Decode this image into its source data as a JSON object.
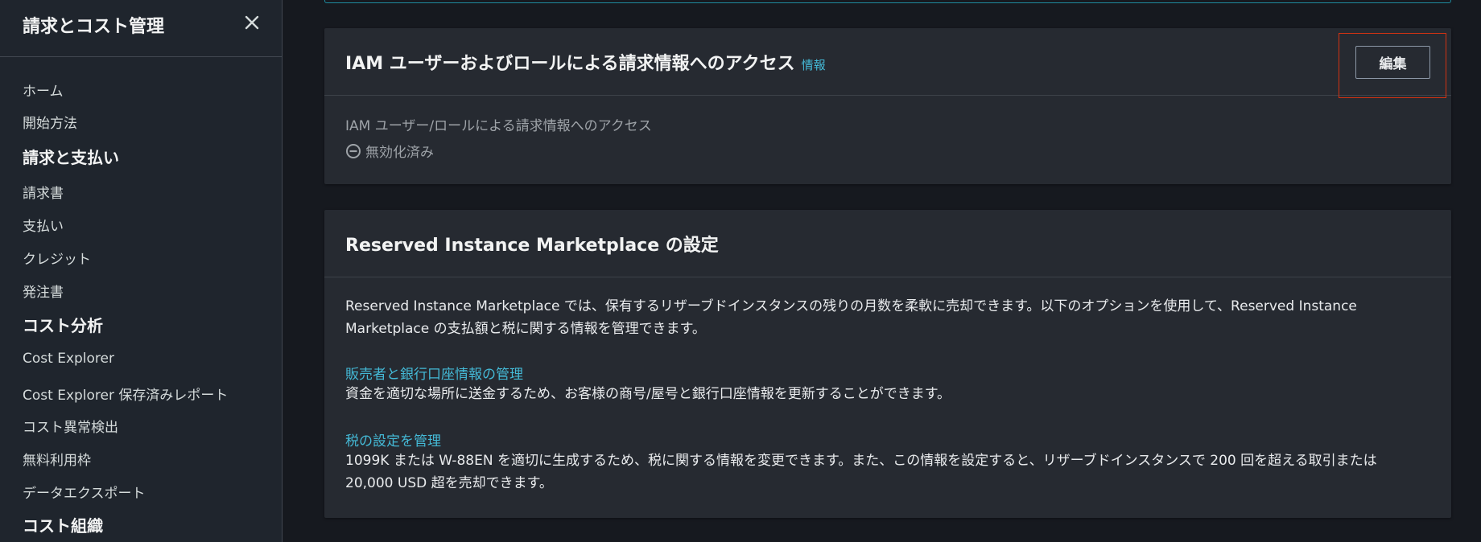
{
  "sidebar": {
    "title": "請求とコスト管理",
    "items": {
      "home": "ホーム",
      "getting_started": "開始方法",
      "billing_section": "請求と支払い",
      "bills": "請求書",
      "payments": "支払い",
      "credits": "クレジット",
      "purchase_orders": "発注書",
      "cost_analysis_section": "コスト分析",
      "cost_explorer": "Cost Explorer",
      "cost_explorer_saved": "Cost Explorer 保存済みレポート",
      "cost_anomaly": "コスト異常検出",
      "free_tier": "無料利用枠",
      "data_exports": "データエクスポート",
      "cost_org_section": "コスト組織"
    }
  },
  "iam_panel": {
    "title": "IAM ユーザーおよびロールによる請求情報へのアクセス",
    "info_link": "情報",
    "edit_button": "編集",
    "field_label": "IAM ユーザー/ロールによる請求情報へのアクセス",
    "status": "無効化済み"
  },
  "ri_panel": {
    "title": "Reserved Instance Marketplace の設定",
    "description": "Reserved Instance Marketplace では、保有するリザーブドインスタンスの残りの月数を柔軟に売却できます。以下のオプションを使用して、Reserved Instance Marketplace の支払額と税に関する情報を管理できます。",
    "seller_link": "販売者と銀行口座情報の管理",
    "seller_text": "資金を適切な場所に送金するため、お客様の商号/屋号と銀行口座情報を更新することができます。",
    "tax_link": "税の設定を管理",
    "tax_text": "1099K または W-88EN を適切に生成するため、税に関する情報を変更できます。また、この情報を設定すると、リザーブドインスタンスで 200 回を超える取引または 20,000 USD 超を売却できます。"
  }
}
